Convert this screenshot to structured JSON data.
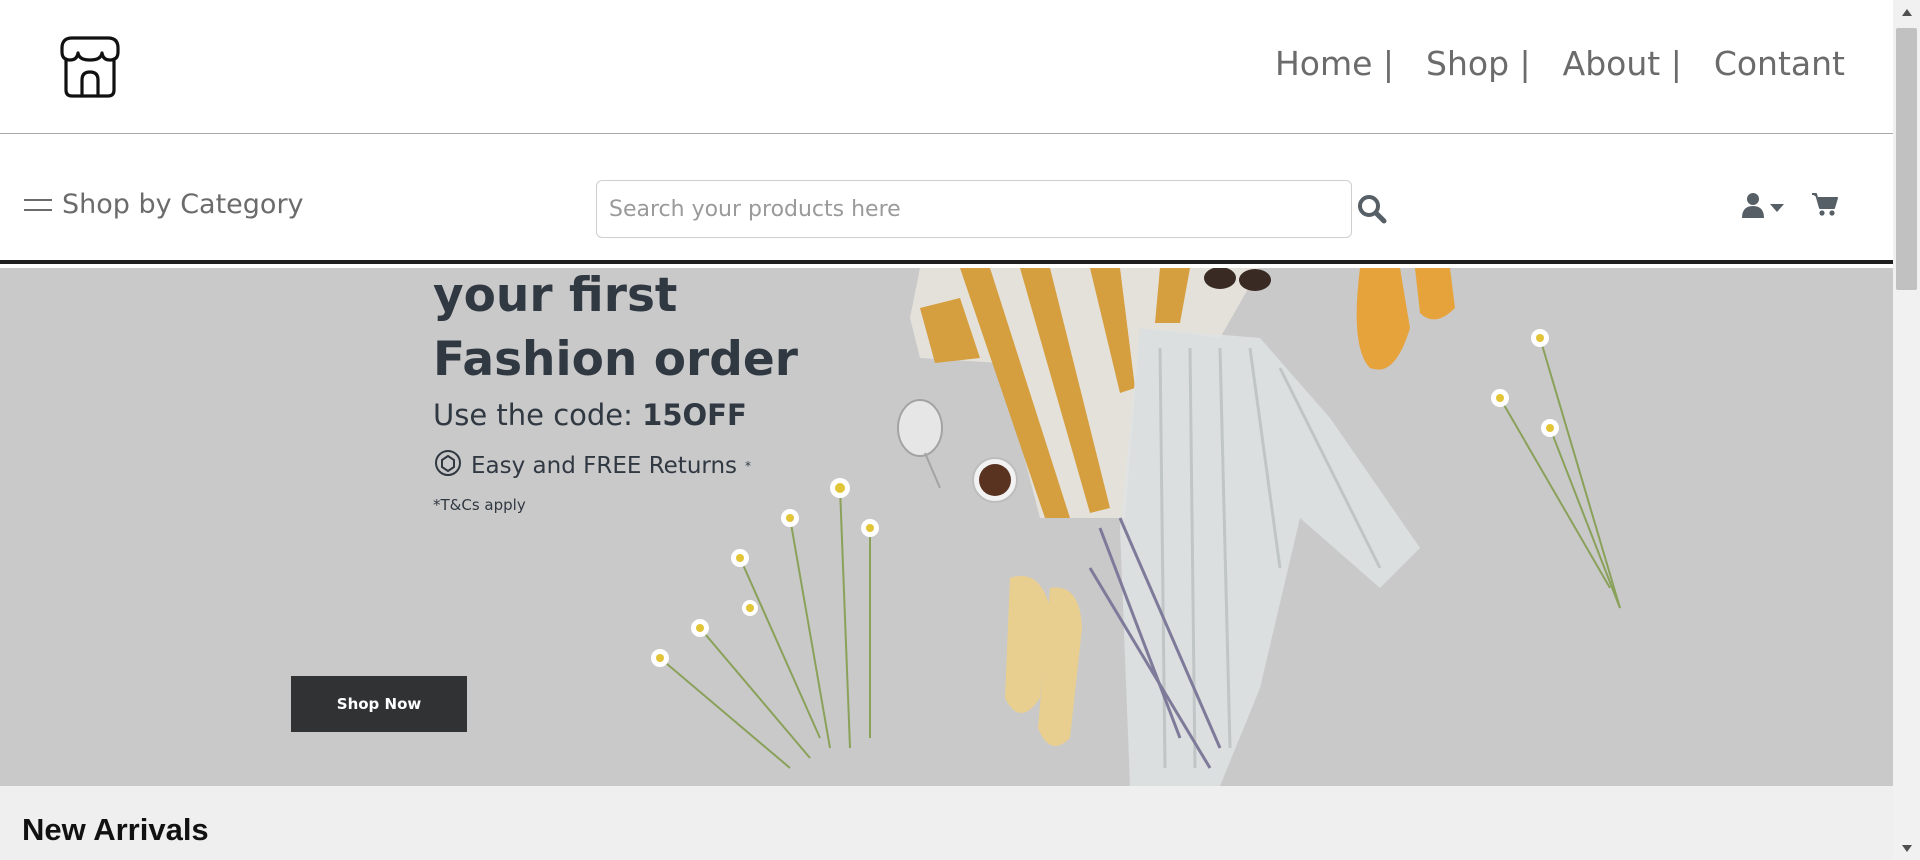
{
  "header": {
    "logo_icon": "storefront-icon",
    "nav": [
      {
        "label": "Home |"
      },
      {
        "label": "Shop |"
      },
      {
        "label": "About |"
      },
      {
        "label": "Contant"
      }
    ]
  },
  "subbar": {
    "category_icon": "menu-icon",
    "category_label": "Shop by Category",
    "search_placeholder": "Search your products here",
    "search_value": "",
    "search_icon": "search-icon",
    "user_icon": "user-icon",
    "dropdown_icon": "caret-down-icon",
    "cart_icon": "cart-icon"
  },
  "hero": {
    "line1": "your first",
    "line2": "Fashion order",
    "code_prefix": "Use the code: ",
    "code": "15OFF",
    "returns_icon": "returns-icon",
    "returns_text": "Easy and FREE Returns",
    "returns_mark": "*",
    "tc": "*T&Cs apply",
    "button_label": "Shop Now",
    "background_color": "#c9c9ca"
  },
  "sections": {
    "new_arrivals_title": "New Arrivals"
  },
  "colors": {
    "nav_text": "#6b6b6b",
    "hero_text": "#303841",
    "button_bg": "#303233",
    "section_bg": "#efefef"
  }
}
